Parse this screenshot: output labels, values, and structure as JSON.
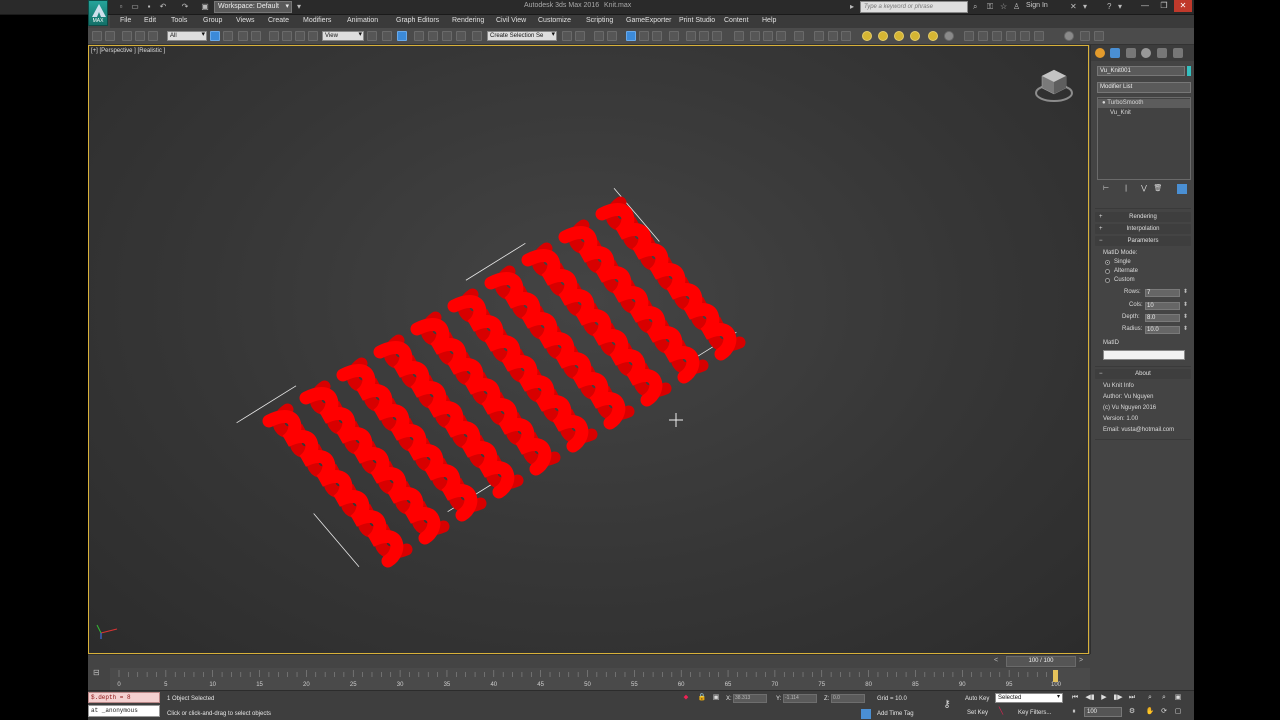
{
  "title_bar": {
    "workspace": "Workspace: Default",
    "app_title": "Autodesk 3ds Max 2016",
    "file_name": "Knit.max",
    "search_placeholder": "Type a keyword or phrase",
    "sign_in": "Sign In",
    "logo_label": "MAX"
  },
  "menu": [
    "File",
    "Edit",
    "Tools",
    "Group",
    "Views",
    "Create",
    "Modifiers",
    "Animation",
    "Graph Editors",
    "Rendering",
    "Civil View",
    "Customize",
    "Scripting",
    "GameExporter",
    "Print Studio",
    "Content",
    "Help"
  ],
  "toolbar": {
    "selection_filter": "All",
    "reference_coord": "View",
    "named_selection": "Create Selection Se"
  },
  "viewport": {
    "label": "[+] [Perspective ] [Realistic ]",
    "knit_color": "#ff0000",
    "knit_rows": 7,
    "knit_cols": 10
  },
  "command_panel": {
    "object_name": "Vu_Knit001",
    "object_color": "#35c0c0",
    "modifier_list": "Modifier List",
    "stack": [
      "TurboSmooth",
      "Vu_Knit"
    ],
    "rollouts": {
      "rendering": "Rendering",
      "interpolation": "Interpolation",
      "parameters": "Parameters",
      "about": "About"
    },
    "params": {
      "matid_mode_label": "MatID Mode:",
      "modes": [
        "Single",
        "Alternate",
        "Custom"
      ],
      "selected_mode": "Single",
      "rows_label": "Rows:",
      "rows": "7",
      "cols_label": "Cols:",
      "cols": "10",
      "depth_label": "Depth:",
      "depth": "8.0",
      "radius_label": "Radius:",
      "radius": "10.0",
      "matid_label": "MatID"
    },
    "about": {
      "line1": "Vu Knit Info",
      "line2": "Author: Vu Nguyen",
      "line3": "(c) Vu Nguyen 2016",
      "line4": "Version: 1.00",
      "line5": "Email: vusta@hotmail.com"
    }
  },
  "timeline": {
    "frame_counter": "100 / 100",
    "ticks": [
      "0",
      "5",
      "10",
      "15",
      "20",
      "25",
      "30",
      "35",
      "40",
      "45",
      "50",
      "55",
      "60",
      "65",
      "70",
      "75",
      "80",
      "85",
      "90",
      "95",
      "100"
    ],
    "current_frame": 100
  },
  "status": {
    "maxscript_input": "$.depth = 8",
    "maxscript_output": "at _anonymous",
    "selection_info": "1 Object Selected",
    "prompt": "Click or click-and-drag to select objects",
    "x_label": "X:",
    "x_value": "38.313",
    "y_label": "Y:",
    "y_value": "-1.114",
    "z_label": "Z:",
    "z_value": "0.0",
    "grid": "Grid = 10.0",
    "add_time_tag": "Add Time Tag",
    "auto_key": "Auto Key",
    "selected": "Selected",
    "set_key": "Set Key",
    "key_filters": "Key Filters...",
    "frame_input": "100"
  }
}
